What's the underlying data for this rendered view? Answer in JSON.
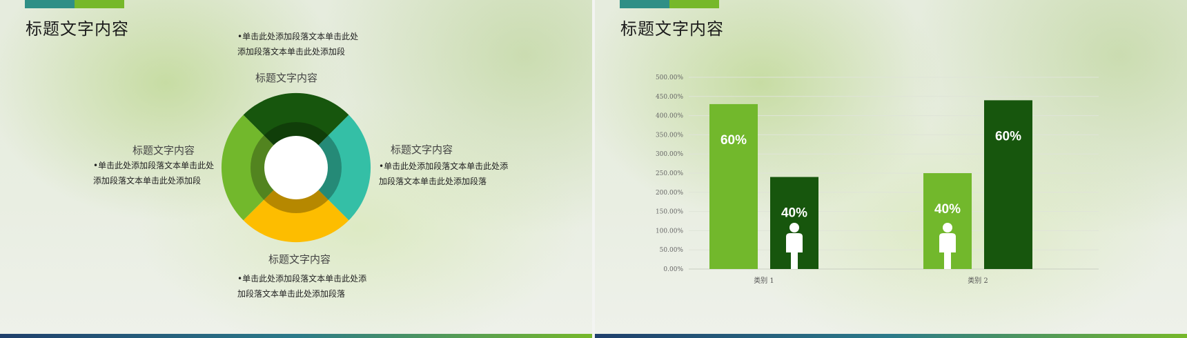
{
  "left_slide": {
    "title": "标题文字内容",
    "segments": [
      {
        "label": "标题文字内容",
        "text_line1": "•单击此处添加段落文本单击此处",
        "text_line2": "添加段落文本单击此处添加段",
        "color": "#17560d"
      },
      {
        "label": "标题文字内容",
        "text_line1": "•单击此处添加段落文本单击此处添",
        "text_line2": "加段落文本单击此处添加段落",
        "color": "#34bfa6"
      },
      {
        "label": "标题文字内容",
        "text_line1": "•单击此处添加段落文本单击此处添",
        "text_line2": "加段落文本单击此处添加段落",
        "color": "#fdbd00"
      },
      {
        "label": "标题文字内容",
        "text_line1": "•单击此处添加段落文本单击此处",
        "text_line2": "添加段落文本单击此处添加段",
        "color": "#72b82c"
      }
    ]
  },
  "right_slide": {
    "title": "标题文字内容"
  },
  "chart_data": {
    "type": "bar",
    "categories": [
      "类别 1",
      "类别 2"
    ],
    "series": [
      {
        "values": [
          4.3,
          2.5
        ],
        "labels": [
          "60%",
          "40%"
        ],
        "color": "#72b82c"
      },
      {
        "values": [
          2.4,
          4.4
        ],
        "labels": [
          "40%",
          "60%"
        ],
        "color": "#17560d"
      }
    ],
    "yticks": [
      "0.00%",
      "50.00%",
      "100.00%",
      "150.00%",
      "200.00%",
      "250.00%",
      "300.00%",
      "350.00%",
      "400.00%",
      "450.00%",
      "500.00%"
    ],
    "ylim": [
      0,
      5
    ],
    "grid": true,
    "annotations": [
      "person-icon on series 2 bar of 类别 1",
      "person-icon on series 1 bar of 类别 2"
    ]
  },
  "colors": {
    "dark_green": "#17560d",
    "light_green": "#72b82c",
    "teal": "#34bfa6",
    "yellow": "#fdbd00"
  }
}
